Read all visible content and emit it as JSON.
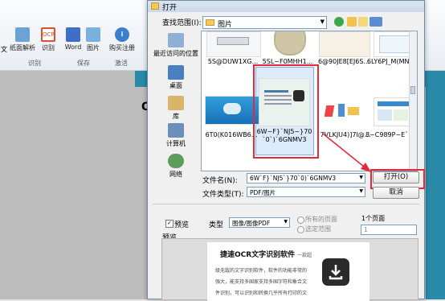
{
  "ribbon": {
    "left_fragment": "文",
    "buttons": [
      {
        "label": "纸面解析",
        "icon": "paper-parse-icon"
      },
      {
        "label": "识别",
        "icon": "ocr-icon"
      },
      {
        "label": "Word",
        "icon": "word-icon"
      },
      {
        "label": "图片",
        "icon": "image-icon"
      },
      {
        "label": "购买注册",
        "icon": "info-icon"
      }
    ],
    "groups": [
      "识别",
      "保存",
      "激活"
    ]
  },
  "background": {
    "fragment": "O"
  },
  "dialog": {
    "title": "打开",
    "look_in_label": "查找范围(I):",
    "look_in_value": "图片",
    "places": [
      {
        "label": "最近访问的位置",
        "icon": "recent-places-icon"
      },
      {
        "label": "桌面",
        "icon": "desktop-icon"
      },
      {
        "label": "库",
        "icon": "libraries-icon"
      },
      {
        "label": "计算机",
        "icon": "computer-icon"
      },
      {
        "label": "网络",
        "icon": "network-icon"
      }
    ],
    "files": [
      {
        "name": "5S@DUW1XG..."
      },
      {
        "name": "5SL~F0MHH1..."
      },
      {
        "name": "6@90JE8[EJ6S..."
      },
      {
        "name": "6LY6PJ_M(MN..."
      },
      {
        "name": "6T0(K016WB6..."
      },
      {
        "name": "6W~F}`NJ5~}70`0`)`6GNMV3"
      },
      {
        "name": "7VLKJU4)]7I@..."
      },
      {
        "name": "8~C989P~E`P..."
      }
    ],
    "filename_label": "文件名(N):",
    "filename_value": "6W`F}`NJ5`}70`0)`6GNMV3",
    "filetype_label": "文件类型(T):",
    "filetype_value": "PDF/图片",
    "open_button": "打开(O)",
    "cancel_button": "取消",
    "preview_checkbox": "预览",
    "preview_checked": true,
    "type_label": "类型",
    "type_value": "图像/图像PDF",
    "page_options": [
      "所有的页面",
      "选定范围"
    ],
    "page_count_label": "1个页面",
    "page_range_value": "1",
    "preview_label": "预览",
    "preview_doc": {
      "title": "捷速OCR文字识别软件",
      "title_suffix": "一款超",
      "lines": [
        "级无敌的文字识别软件，软件的功能非常的",
        "强大，能支持多国家支持多国字符和象合文",
        "件识别，可以识别和转换几乎所有打印的文"
      ]
    }
  }
}
